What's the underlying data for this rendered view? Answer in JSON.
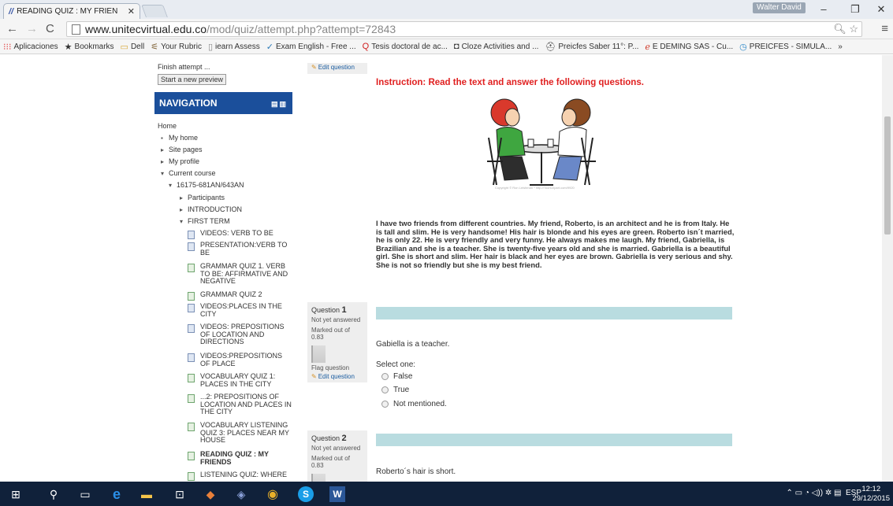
{
  "browser": {
    "tab_title": "READING QUIZ : MY FRIEN",
    "user_chip": "Walter David",
    "url_host": "www.unitecvirtual.edu.co",
    "url_path": "/mod/quiz/attempt.php?attempt=72843",
    "bookmarks": [
      {
        "label": "Aplicaciones",
        "icon": "apps-grid-icon"
      },
      {
        "label": "Bookmarks",
        "icon": "star-icon"
      },
      {
        "label": "Dell",
        "icon": "folder-icon"
      },
      {
        "label": "Your Rubric",
        "icon": "rubric-icon"
      },
      {
        "label": "iearn Assess",
        "icon": "page-icon"
      },
      {
        "label": "Exam English - Free ...",
        "icon": "check-icon"
      },
      {
        "label": "Tesis doctoral de ac...",
        "icon": "q-icon"
      },
      {
        "label": "Cloze Activities and ...",
        "icon": "cloze-icon"
      },
      {
        "label": "Preicfes Saber 11°: P...",
        "icon": "hat-icon"
      },
      {
        "label": "E DEMING SAS - Cu...",
        "icon": "e-icon"
      },
      {
        "label": "PREICFES - SIMULA...",
        "icon": "clock-icon"
      }
    ]
  },
  "sidebar": {
    "finish_attempt": "Finish attempt ...",
    "new_preview": "Start a new preview",
    "nav_title": "NAVIGATION",
    "home": "Home",
    "my_home": "My home",
    "site_pages": "Site pages",
    "my_profile": "My profile",
    "current_course": "Current course",
    "course_code": "16175-681AN/643AN",
    "participants": "Participants",
    "introduction": "INTRODUCTION",
    "first_term": "FIRST TERM",
    "items": [
      {
        "label": "VIDEOS: VERB TO BE",
        "kind": "page"
      },
      {
        "label": "PRESENTATION:VERB TO BE",
        "kind": "page"
      },
      {
        "label": "GRAMMAR QUIZ 1. VERB TO BE: AFFIRMATIVE AND NEGATIVE",
        "kind": "quiz"
      },
      {
        "label": "GRAMMAR QUIZ 2",
        "kind": "quiz"
      },
      {
        "label": "VIDEOS:PLACES IN THE CITY",
        "kind": "page"
      },
      {
        "label": "VIDEOS: PREPOSITIONS OF LOCATION AND DIRECTIONS",
        "kind": "page"
      },
      {
        "label": "VIDEOS:PREPOSITIONS OF PLACE",
        "kind": "page"
      },
      {
        "label": "VOCABULARY QUIZ 1: PLACES IN THE CITY",
        "kind": "quiz"
      },
      {
        "label": "...2: PREPOSITIONS OF LOCATION AND PLACES IN THE CITY",
        "kind": "quiz"
      },
      {
        "label": "VOCABULARY LISTENING QUIZ 3: PLACES NEAR MY HOUSE",
        "kind": "quiz"
      },
      {
        "label": "READING QUIZ : MY FRIENDS",
        "kind": "quiz"
      },
      {
        "label": "LISTENING QUIZ: WHERE",
        "kind": "quiz"
      }
    ]
  },
  "quiz": {
    "edit_question": "Edit question",
    "instruction": "Instruction: Read the text and answer the following questions.",
    "image_caption": "Copyright © Ron Leishman * http://ToonClipart.com/9920",
    "passage": "I have two friends from different countries. My friend, Roberto, is an architect and he is from Italy. He is tall and slim. He is very handsome! His hair is blonde and his eyes are green. Roberto isn´t married, he is only 22. He is very friendly and very funny. He always makes me laugh. My friend, Gabriella, is Brazilian and she is a teacher. She is twenty-five years old and she is married. Gabriella is a beautiful girl. She is short and slim. Her hair is black and her eyes are brown. Gabriella is very serious and shy. She is not so friendly but she is my best friend.",
    "questions": [
      {
        "label": "Question",
        "number": "1",
        "status": "Not yet answered",
        "marked": "Marked out of 0.83",
        "flag": "Flag question",
        "text": "Gabiella is a teacher.",
        "select_one": "Select one:",
        "options": [
          "False",
          "True",
          "Not mentioned."
        ]
      },
      {
        "label": "Question",
        "number": "2",
        "status": "Not yet answered",
        "marked": "Marked out of 0.83",
        "text": "Roberto´s hair is short."
      }
    ]
  },
  "taskbar": {
    "lang": "ESP",
    "time": "12:12",
    "date": "29/12/2015"
  }
}
